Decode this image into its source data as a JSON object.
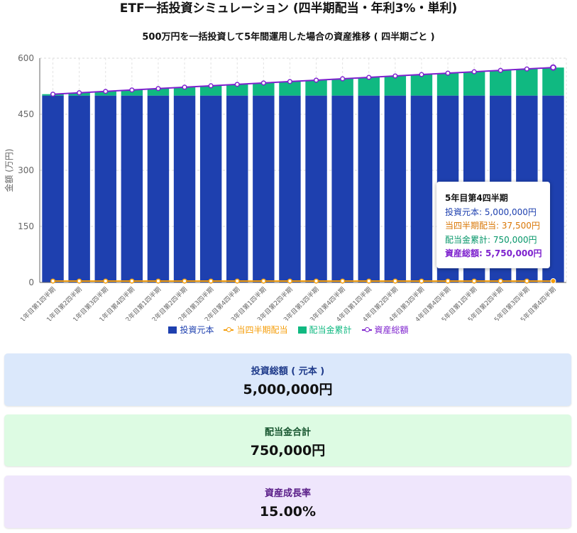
{
  "page": {
    "title": "ETF一括投資シミュレーション (四半期配当・年利3%・単利)",
    "subtitle": "500万円を一括投資して5年間運用した場合の資産推移 ( 四半期ごと )"
  },
  "chart_data": {
    "type": "bar",
    "stacked": true,
    "categories": [
      "1年目第1四半期",
      "1年目第2四半期",
      "1年目第3四半期",
      "1年目第4四半期",
      "2年目第1四半期",
      "2年目第2四半期",
      "2年目第3四半期",
      "2年目第4四半期",
      "3年目第1四半期",
      "3年目第2四半期",
      "3年目第3四半期",
      "3年目第4四半期",
      "4年目第1四半期",
      "4年目第2四半期",
      "4年目第3四半期",
      "4年目第4四半期",
      "5年目第1四半期",
      "5年目第2四半期",
      "5年目第3四半期",
      "5年目第4四半期"
    ],
    "ylabel": "金額 (万円)",
    "ylim": [
      0,
      600
    ],
    "yticks": [
      0,
      150,
      300,
      450,
      600
    ],
    "grid": true,
    "legend_position": "bottom",
    "series": [
      {
        "name": "投資元本",
        "kind": "bar",
        "color": "#1e40af",
        "values": [
          500,
          500,
          500,
          500,
          500,
          500,
          500,
          500,
          500,
          500,
          500,
          500,
          500,
          500,
          500,
          500,
          500,
          500,
          500,
          500
        ]
      },
      {
        "name": "当四半期配当",
        "kind": "line",
        "color": "#f59e0b",
        "values": [
          3.75,
          3.75,
          3.75,
          3.75,
          3.75,
          3.75,
          3.75,
          3.75,
          3.75,
          3.75,
          3.75,
          3.75,
          3.75,
          3.75,
          3.75,
          3.75,
          3.75,
          3.75,
          3.75,
          3.75
        ]
      },
      {
        "name": "配当金累計",
        "kind": "bar",
        "color": "#10b981",
        "values": [
          3.75,
          7.5,
          11.25,
          15,
          18.75,
          22.5,
          26.25,
          30,
          33.75,
          37.5,
          41.25,
          45,
          48.75,
          52.5,
          56.25,
          60,
          63.75,
          67.5,
          71.25,
          75
        ]
      },
      {
        "name": "資産総額",
        "kind": "line",
        "color": "#7e22ce",
        "values": [
          503.75,
          507.5,
          511.25,
          515,
          518.75,
          522.5,
          526.25,
          530,
          533.75,
          537.5,
          541.25,
          545,
          548.75,
          552.5,
          556.25,
          560,
          563.75,
          567.5,
          571.25,
          575
        ]
      }
    ],
    "tooltip": {
      "title": "5年目第4四半期",
      "rows": [
        {
          "text": "投資元本: 5,000,000円",
          "color": "#1e40af"
        },
        {
          "text": "当四半期配当: 37,500円",
          "color": "#d97706"
        },
        {
          "text": "配当金累計: 750,000円",
          "color": "#059669"
        },
        {
          "text": "資産総額: 5,750,000円",
          "color": "#7e22ce"
        }
      ]
    }
  },
  "summary": {
    "principal_label": "投資総額 ( 元本 )",
    "principal_value": "5,000,000円",
    "dividend_label": "配当金合計",
    "dividend_value": "750,000円",
    "growth_label": "資産成長率",
    "growth_value": "15.00%"
  }
}
